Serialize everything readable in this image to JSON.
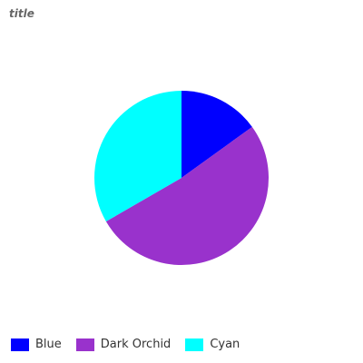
{
  "chart_data": {
    "type": "pie",
    "title": "title",
    "categories": [
      "Blue",
      "Dark Orchid",
      "Cyan"
    ],
    "values": [
      14,
      48,
      31
    ],
    "colors": [
      "#0000ff",
      "#9932cc",
      "#00ffff"
    ],
    "legend_position": "bottom-left",
    "start_angle_deg": 0,
    "direction": "clockwise"
  }
}
